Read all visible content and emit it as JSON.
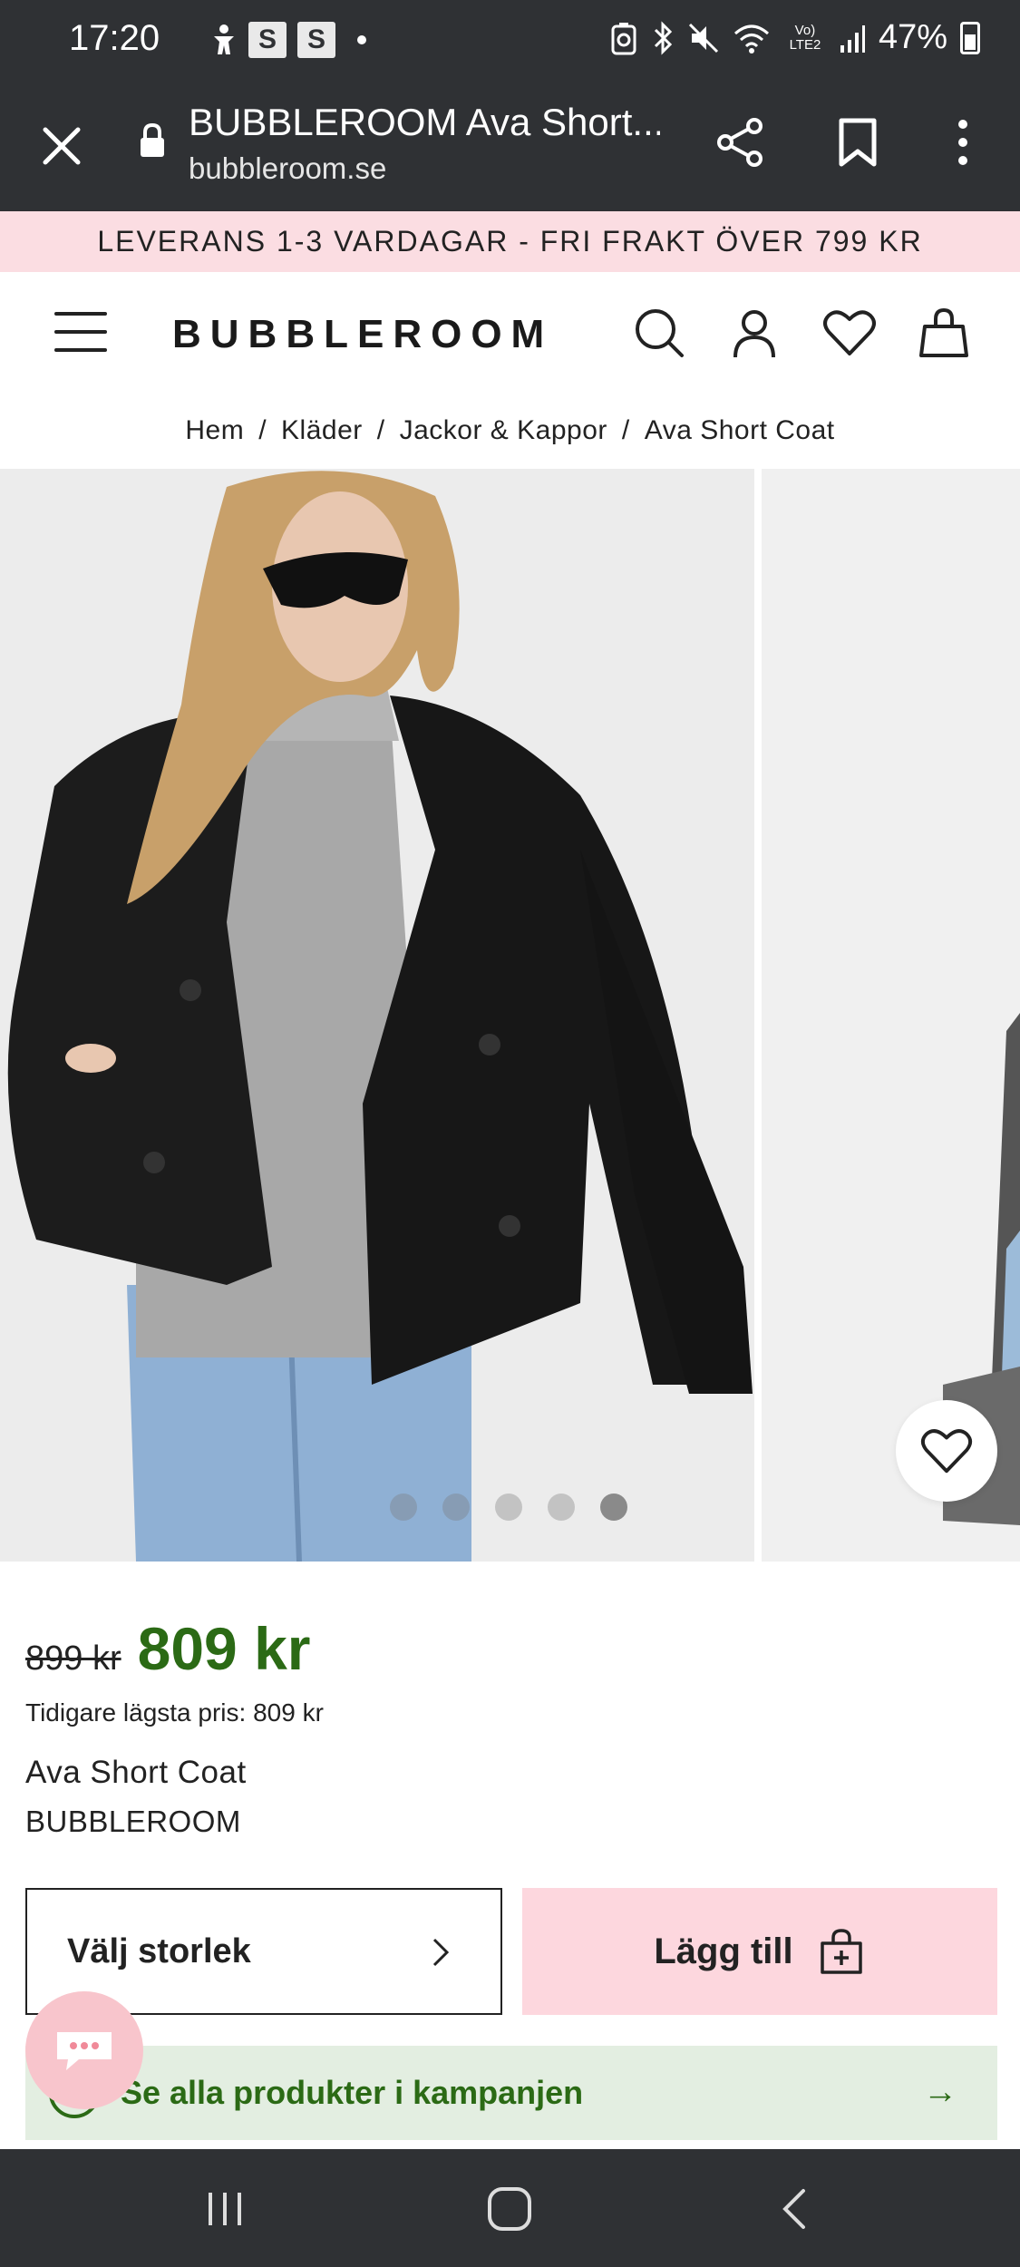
{
  "status_bar": {
    "time": "17:20",
    "badge_1": "S",
    "badge_2": "S",
    "battery": "47%",
    "network_label": "Vo) LTE2"
  },
  "browser": {
    "title": "BUBBLEROOM Ava Short...",
    "url": "bubbleroom.se"
  },
  "promo": {
    "text": "LEVERANS 1-3 VARDAGAR - FRI FRAKT ÖVER 799 KR"
  },
  "header": {
    "logo": "BUBBLEROOM"
  },
  "breadcrumb": {
    "items": [
      "Hem",
      "Kläder",
      "Jackor & Kappor",
      "Ava Short Coat"
    ],
    "separator": "/"
  },
  "gallery": {
    "image_count": 5,
    "active_index": 4
  },
  "product": {
    "old_price": "899 kr",
    "price": "809 kr",
    "lowest_price_text": "Tidigare lägsta pris: 809 kr",
    "name": "Ava Short Coat",
    "brand": "BUBBLEROOM",
    "size_button": "Välj storlek",
    "add_button": "Lägg till",
    "campaign_link": "Se alla produkter i kampanjen",
    "campaign_arrow": "→"
  },
  "colors": {
    "price_green": "#2b6a15",
    "promo_pink": "#fbdde2",
    "add_pink": "#fdd7de",
    "campaign_bg": "#e3eee1",
    "system_bar": "#2f3134"
  },
  "icons": [
    "close-icon",
    "lock-icon",
    "share-icon",
    "bookmark-icon",
    "more-icon",
    "menu-icon",
    "search-icon",
    "account-icon",
    "heart-icon",
    "bag-icon",
    "chevron-right-icon",
    "bag-plus-icon",
    "chat-icon",
    "recents-icon",
    "home-icon",
    "back-icon"
  ]
}
